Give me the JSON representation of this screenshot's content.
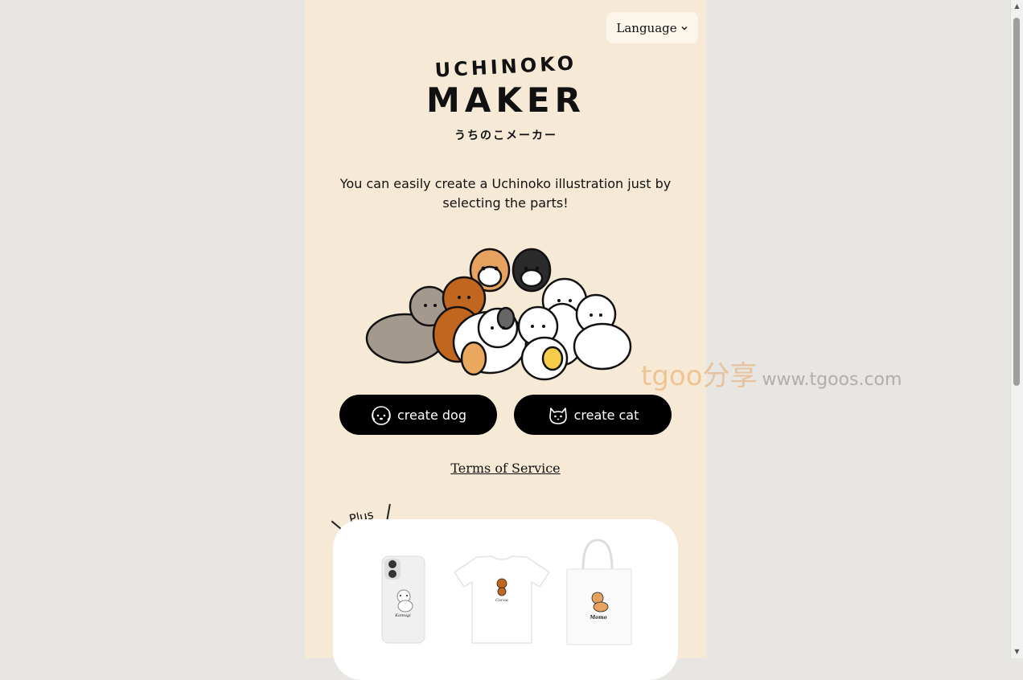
{
  "header": {
    "language_label": "Language"
  },
  "logo": {
    "line1": "UCHINOKO",
    "line2": "MAKER",
    "line3": "うちのこメーカー"
  },
  "tagline": "You can easily create a Uchinoko illustration just by selecting the parts!",
  "buttons": {
    "create_dog": "create dog",
    "create_cat": "create cat"
  },
  "links": {
    "terms": "Terms of Service"
  },
  "plus": {
    "label": "Plus",
    "goods": [
      {
        "type": "phone-case",
        "pet_name": "Kamugi"
      },
      {
        "type": "t-shirt",
        "pet_name": "Cocoa"
      },
      {
        "type": "tote-bag",
        "pet_name": "Momo"
      }
    ]
  },
  "watermark": {
    "brand": "tgoo分享",
    "url": "www.tgoos.com"
  },
  "colors": {
    "page_bg": "#f6ead6",
    "outer_bg": "#e8e6e2",
    "button_bg": "#000000",
    "button_text": "#ffffff"
  }
}
